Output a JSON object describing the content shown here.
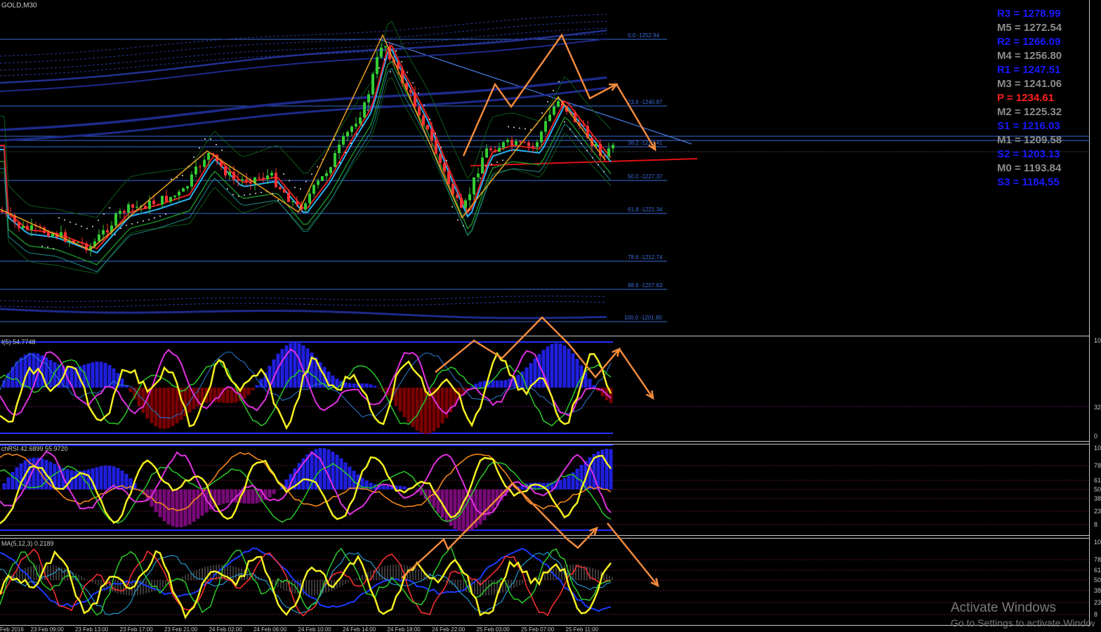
{
  "window_title": "GOLD,M30",
  "pivots": [
    {
      "label": "R3 = 1278.99",
      "color": "#1a1aff"
    },
    {
      "label": "M5 = 1272.54",
      "color": "#8c8c8c"
    },
    {
      "label": "R2 = 1266.09",
      "color": "#1a1aff"
    },
    {
      "label": "M4 = 1256.80",
      "color": "#8c8c8c"
    },
    {
      "label": "R1 = 1247.51",
      "color": "#1a1aff"
    },
    {
      "label": "M3 = 1241.06",
      "color": "#8c8c8c"
    },
    {
      "label": "P  = 1234.61",
      "color": "#ff2020"
    },
    {
      "label": "M2 = 1225.32",
      "color": "#8c8c8c"
    },
    {
      "label": "S1 = 1216.03",
      "color": "#1a1aff"
    },
    {
      "label": "M1 = 1209.58",
      "color": "#8c8c8c"
    },
    {
      "label": "S2 = 1203.13",
      "color": "#1a1aff"
    },
    {
      "label": "M0 = 1193.84",
      "color": "#8c8c8c"
    },
    {
      "label": "S3 = 1184.55",
      "color": "#1a1aff"
    }
  ],
  "fib_levels": [
    "0.0 -1252.94",
    "23.6 -1240.87",
    "38.2 -1233.41",
    "50.0 -1227.37",
    "61.8 -1221.34",
    "78.6 -1212.74",
    "88.6 -1207.63",
    "100.0 -1201.80"
  ],
  "indicators": {
    "panel1_label": "I(5) 54.7748",
    "panel2_label": "chRSI 42.6899 55.9720",
    "panel3_label": "MA(5,12,3) 0.2189"
  },
  "right_axis": {
    "p1_top": "10",
    "p1_mid": "32",
    "p1_bottom": "0",
    "p2_levels": [
      "10",
      "78",
      "61",
      "50",
      "38",
      "23",
      "8"
    ],
    "p3_levels": [
      "10",
      "78",
      "61",
      "50",
      "38",
      "23",
      "8"
    ]
  },
  "time_axis": [
    "Feb 2016",
    "23 Feb 09:00",
    "23 Feb 13:00",
    "23 Feb 17:00",
    "23 Feb 21:00",
    "24 Feb 02:00",
    "24 Feb 06:00",
    "24 Feb 10:00",
    "24 Feb 14:00",
    "24 Feb 18:00",
    "24 Feb 22:00",
    "25 Feb 03:00",
    "25 Feb 07:00",
    "25 Feb 11:00"
  ],
  "watermark": {
    "line1": "Activate Windows",
    "line2": "Go to Settings to activate Windows."
  },
  "colors": {
    "bull_candle": "#33cc33",
    "bear_candle": "#ff3333",
    "fib_line": "#3a6bd6",
    "arrow": "#f08a3c",
    "histogram_pos": "#1f1fe0",
    "histogram_neg": "#7a0000",
    "histogram_neg2": "#7a0a7a"
  }
}
